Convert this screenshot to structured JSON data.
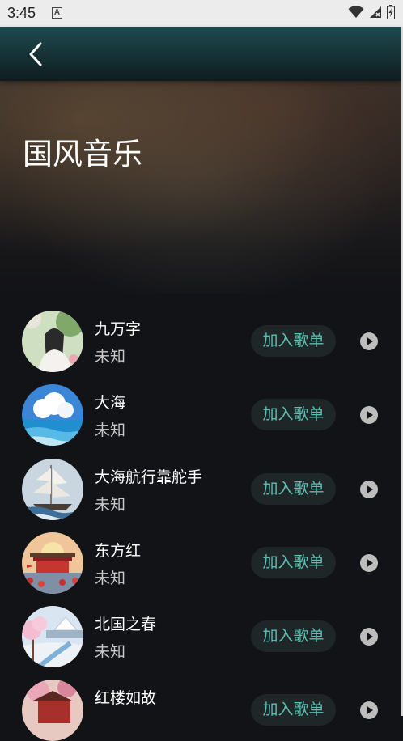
{
  "status_bar": {
    "time": "3:45",
    "notification_icon": "A",
    "icons": [
      "wifi-icon",
      "signal-icon",
      "battery-icon"
    ]
  },
  "header": {
    "back_icon": "chevron-left-icon"
  },
  "page": {
    "title": "国风音乐"
  },
  "songs": [
    {
      "title": "九万字",
      "artist": "未知",
      "add_label": "加入歌单",
      "cover": "portrait-woman-flowers"
    },
    {
      "title": "大海",
      "artist": "未知",
      "add_label": "加入歌单",
      "cover": "sea-clouds"
    },
    {
      "title": "大海航行靠舵手",
      "artist": "未知",
      "add_label": "加入歌单",
      "cover": "sailing-ship"
    },
    {
      "title": "东方红",
      "artist": "未知",
      "add_label": "加入歌单",
      "cover": "tiananmen-sunrise"
    },
    {
      "title": "北国之春",
      "artist": "未知",
      "add_label": "加入歌单",
      "cover": "snowy-landscape-blossom"
    },
    {
      "title": "红楼如故",
      "artist": "",
      "add_label": "加入歌单",
      "cover": "red-pavilion"
    }
  ],
  "colors": {
    "accent": "#5dbfb3",
    "background": "#121317",
    "topbar": "#1d4a4f"
  }
}
